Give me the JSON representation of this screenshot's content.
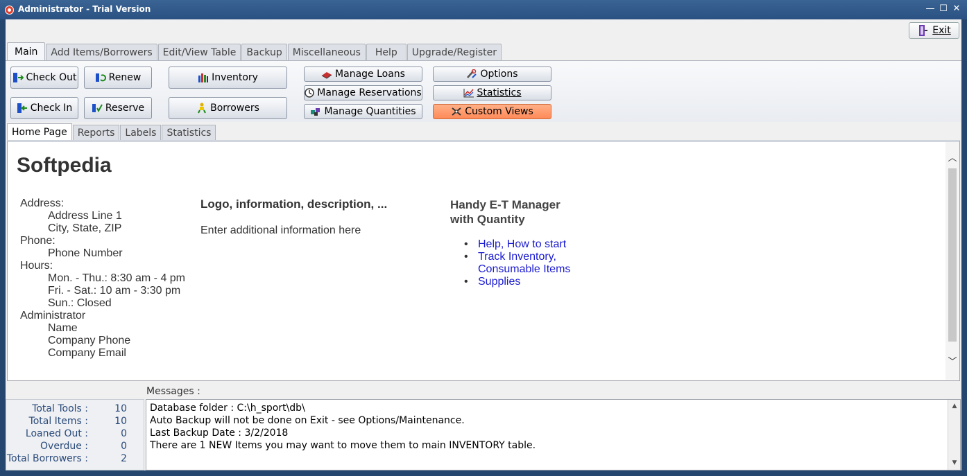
{
  "window": {
    "title": "Administrator - Trial Version",
    "minimize": "—",
    "maximize": "☐",
    "close": "✕"
  },
  "exit": {
    "label": "Exit"
  },
  "main_tabs": [
    {
      "label": "Main"
    },
    {
      "label": "Add Items/Borrowers"
    },
    {
      "label": "Edit/View Table"
    },
    {
      "label": "Backup"
    },
    {
      "label": "Miscellaneous"
    },
    {
      "label": "Help"
    },
    {
      "label": "Upgrade/Register"
    }
  ],
  "buttons": {
    "check_out": "Check Out",
    "renew": "Renew",
    "inventory": "Inventory",
    "check_in": "Check In",
    "reserve": "Reserve",
    "borrowers": "Borrowers",
    "manage_loans": "Manage Loans",
    "manage_reservations": "Manage Reservations",
    "manage_quantities": "Manage Quantities",
    "options": "Options",
    "statistics": "Statistics",
    "custom_views": "Custom Views"
  },
  "sub_tabs": [
    {
      "label": "Home Page"
    },
    {
      "label": "Reports"
    },
    {
      "label": "Labels"
    },
    {
      "label": "Statistics"
    }
  ],
  "home": {
    "company": "Softpedia",
    "address_label": "Address:",
    "address_line1": "Address Line 1",
    "address_line2": "City, State, ZIP",
    "phone_label": "Phone:",
    "phone": "Phone Number",
    "hours_label": "Hours:",
    "hours1": "Mon. - Thu.: 8:30 am - 4 pm",
    "hours2": "Fri. - Sat.: 10 am - 3:30 pm",
    "hours3": "Sun.: Closed",
    "admin_label": "Administrator",
    "admin_name": "Name",
    "admin_phone": "Company Phone",
    "admin_email": "Company Email",
    "mid_heading": "Logo, information, description, ...",
    "mid_text": "Enter additional information here",
    "right_heading_1": "Handy E-T Manager",
    "right_heading_2": "with Quantity",
    "links": [
      {
        "line1": "Help, How to start",
        "line2": ""
      },
      {
        "line1": "Track Inventory,",
        "line2": "Consumable Items"
      },
      {
        "line1": "Supplies",
        "line2": ""
      }
    ]
  },
  "messages": {
    "label": "Messages :",
    "lines": [
      "Database folder : C:\\h_sport\\db\\",
      "Auto Backup will not be done on Exit - see Options/Maintenance.",
      "Last Backup Date : 3/2/2018",
      "There are 1 NEW Items you may want to move them to main INVENTORY table."
    ]
  },
  "stats": [
    {
      "label": "Total Tools :",
      "value": "10"
    },
    {
      "label": "Total Items :",
      "value": "10"
    },
    {
      "label": "Loaned Out :",
      "value": "0"
    },
    {
      "label": "Overdue :",
      "value": "0"
    },
    {
      "label": "Total Borrowers :",
      "value": "2"
    }
  ]
}
